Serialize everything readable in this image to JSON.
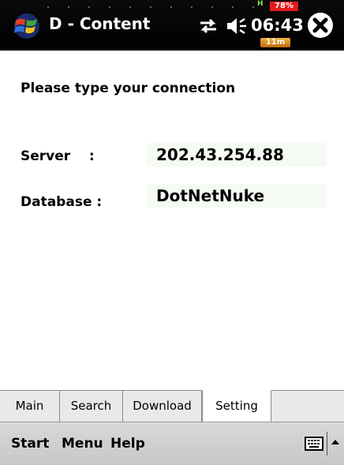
{
  "titlebar": {
    "title": "D - Content",
    "time": "06:43",
    "battery": "78%",
    "signal": "11m",
    "hsdpa_indicator": "H"
  },
  "icons": {
    "start": "windows-flag-icon",
    "connectivity": "connectivity-arrows-icon",
    "volume": "speaker-icon",
    "close": "close-icon",
    "keyboard": "keyboard-icon",
    "sip_arrow": "arrow-up-icon"
  },
  "content": {
    "prompt": "Please type your connection",
    "server_label": "Server    :",
    "server_value": "202.43.254.88",
    "database_label": "Database :",
    "database_value": "DotNetNuke"
  },
  "tabs": [
    {
      "label": "Main"
    },
    {
      "label": "Search"
    },
    {
      "label": "Download"
    },
    {
      "label": "Setting",
      "active": true
    }
  ],
  "menubar": {
    "start": "Start",
    "menu": "Menu",
    "help": "Help"
  },
  "colors": {
    "titlebar": "#000000",
    "battery": "#e21a1a",
    "signal_badge": "#e08a1a",
    "field_bg": "#f5faf3",
    "menubar": "#cfcfcf"
  }
}
